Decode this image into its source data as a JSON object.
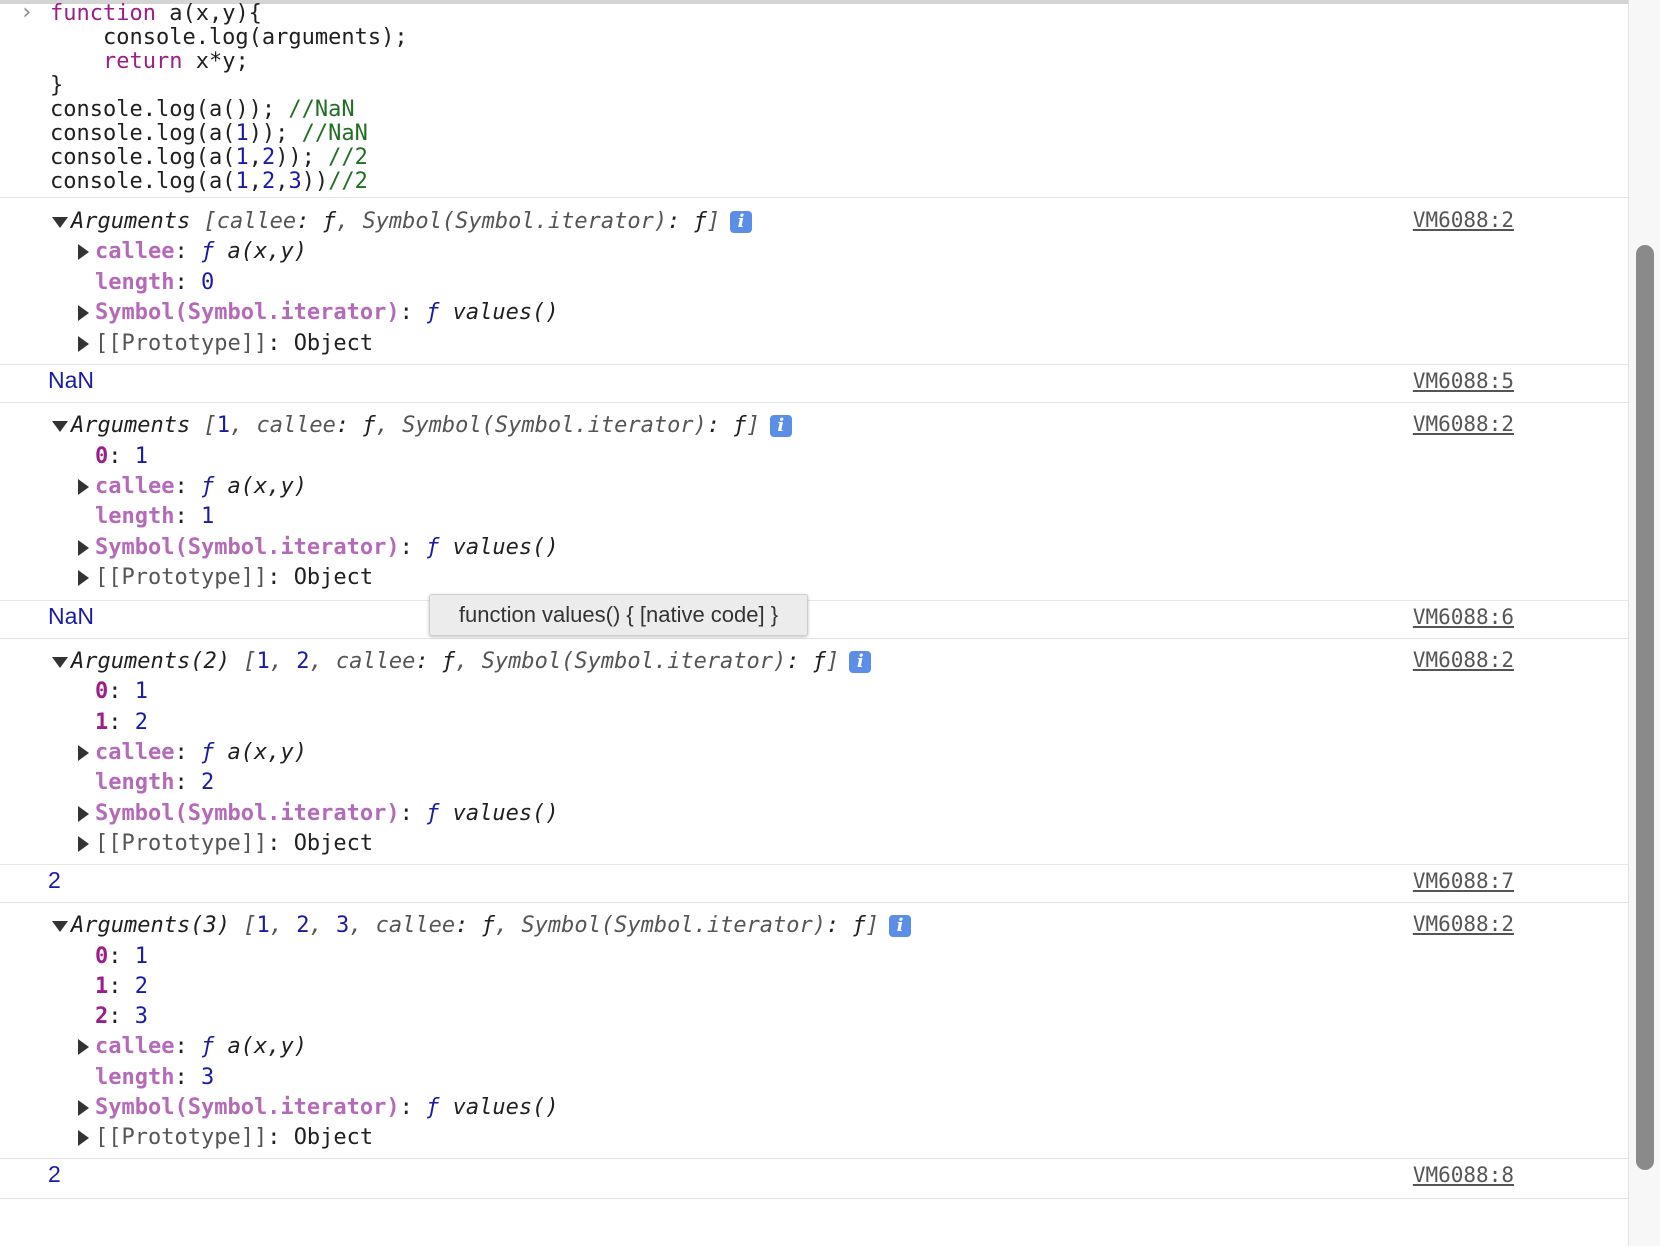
{
  "input": {
    "prompt_symbol": "›",
    "code": [
      {
        "parts": [
          {
            "c": "kw",
            "t": "function"
          },
          {
            "c": "",
            "t": " a(x,y){"
          }
        ]
      },
      {
        "parts": [
          {
            "c": "",
            "t": "    console.log(arguments);"
          }
        ]
      },
      {
        "parts": [
          {
            "c": "",
            "t": "    "
          },
          {
            "c": "kw",
            "t": "return"
          },
          {
            "c": "",
            "t": " x*y;"
          }
        ]
      },
      {
        "parts": [
          {
            "c": "",
            "t": "}"
          }
        ]
      },
      {
        "parts": [
          {
            "c": "",
            "t": "console.log(a()); "
          },
          {
            "c": "cm",
            "t": "//NaN"
          }
        ]
      },
      {
        "parts": [
          {
            "c": "",
            "t": "console.log(a("
          },
          {
            "c": "num",
            "t": "1"
          },
          {
            "c": "",
            "t": ")); "
          },
          {
            "c": "cm",
            "t": "//NaN"
          }
        ]
      },
      {
        "parts": [
          {
            "c": "",
            "t": "console.log(a("
          },
          {
            "c": "num",
            "t": "1"
          },
          {
            "c": "",
            "t": ","
          },
          {
            "c": "num",
            "t": "2"
          },
          {
            "c": "",
            "t": ")); "
          },
          {
            "c": "cm",
            "t": "//2"
          }
        ]
      },
      {
        "parts": [
          {
            "c": "",
            "t": "console.log(a("
          },
          {
            "c": "num",
            "t": "1"
          },
          {
            "c": "",
            "t": ","
          },
          {
            "c": "num",
            "t": "2"
          },
          {
            "c": "",
            "t": ","
          },
          {
            "c": "num",
            "t": "3"
          },
          {
            "c": "",
            "t": "))"
          },
          {
            "c": "cm",
            "t": "//2"
          }
        ]
      }
    ]
  },
  "groups": [
    {
      "source": "VM6088:2",
      "summary": [
        {
          "c": "it",
          "t": "Arguments "
        },
        {
          "c": "it gy",
          "t": "["
        },
        {
          "c": "it gy",
          "t": "callee"
        },
        {
          "c": "it",
          "t": ": "
        },
        {
          "c": "it",
          "t": "ƒ"
        },
        {
          "c": "it gy",
          "t": ", "
        },
        {
          "c": "it gy",
          "t": "Symbol(Symbol.iterator)"
        },
        {
          "c": "it",
          "t": ": ƒ"
        },
        {
          "c": "it gy",
          "t": "]"
        }
      ],
      "props": [
        {
          "kind": "obj",
          "key": "callee",
          "keyc": "pf",
          "val": [
            {
              "c": "fn",
              "t": "ƒ"
            },
            {
              "c": "it",
              "t": " a(x,y)"
            }
          ]
        },
        {
          "kind": "leaf",
          "key": "length",
          "keyc": "pf",
          "val": [
            {
              "c": "num",
              "t": "0"
            }
          ]
        },
        {
          "kind": "obj",
          "key": "Symbol(Symbol.iterator)",
          "keyc": "pf",
          "val": [
            {
              "c": "fn",
              "t": "ƒ"
            },
            {
              "c": "it",
              "t": " values()"
            }
          ]
        },
        {
          "kind": "obj",
          "key": "[[Prototype]]",
          "keyc": "gy",
          "val": [
            {
              "c": "",
              "t": "Object"
            }
          ]
        }
      ],
      "result": {
        "value": "NaN",
        "source": "VM6088:5"
      }
    },
    {
      "source": "VM6088:2",
      "summary": [
        {
          "c": "it",
          "t": "Arguments "
        },
        {
          "c": "it gy",
          "t": "["
        },
        {
          "c": "num",
          "t": "1"
        },
        {
          "c": "it gy",
          "t": ", callee"
        },
        {
          "c": "it",
          "t": ": ƒ"
        },
        {
          "c": "it gy",
          "t": ", Symbol(Symbol.iterator)"
        },
        {
          "c": "it",
          "t": ": ƒ"
        },
        {
          "c": "it gy",
          "t": "]"
        }
      ],
      "props": [
        {
          "kind": "leaf",
          "key": "0",
          "keyc": "pk",
          "val": [
            {
              "c": "num",
              "t": "1"
            }
          ]
        },
        {
          "kind": "obj",
          "key": "callee",
          "keyc": "pf",
          "val": [
            {
              "c": "fn",
              "t": "ƒ"
            },
            {
              "c": "it",
              "t": " a(x,y)"
            }
          ]
        },
        {
          "kind": "leaf",
          "key": "length",
          "keyc": "pf",
          "val": [
            {
              "c": "num",
              "t": "1"
            }
          ]
        },
        {
          "kind": "obj",
          "key": "Symbol(Symbol.iterator)",
          "keyc": "pf",
          "val": [
            {
              "c": "fn",
              "t": "ƒ"
            },
            {
              "c": "it",
              "t": " values()"
            }
          ]
        },
        {
          "kind": "obj",
          "key": "[[Prototype]]",
          "keyc": "gy",
          "val": [
            {
              "c": "",
              "t": "Object"
            }
          ]
        }
      ],
      "result": {
        "value": "NaN",
        "source": "VM6088:6"
      }
    },
    {
      "source": "VM6088:2",
      "summary": [
        {
          "c": "it",
          "t": "Arguments(2) "
        },
        {
          "c": "it gy",
          "t": "["
        },
        {
          "c": "num",
          "t": "1"
        },
        {
          "c": "it gy",
          "t": ", "
        },
        {
          "c": "num",
          "t": "2"
        },
        {
          "c": "it gy",
          "t": ", callee"
        },
        {
          "c": "it",
          "t": ": ƒ"
        },
        {
          "c": "it gy",
          "t": ", Symbol(Symbol.iterator)"
        },
        {
          "c": "it",
          "t": ": ƒ"
        },
        {
          "c": "it gy",
          "t": "]"
        }
      ],
      "props": [
        {
          "kind": "leaf",
          "key": "0",
          "keyc": "pk",
          "val": [
            {
              "c": "num",
              "t": "1"
            }
          ]
        },
        {
          "kind": "leaf",
          "key": "1",
          "keyc": "pk",
          "val": [
            {
              "c": "num",
              "t": "2"
            }
          ]
        },
        {
          "kind": "obj",
          "key": "callee",
          "keyc": "pf",
          "val": [
            {
              "c": "fn",
              "t": "ƒ"
            },
            {
              "c": "it",
              "t": " a(x,y)"
            }
          ]
        },
        {
          "kind": "leaf",
          "key": "length",
          "keyc": "pf",
          "val": [
            {
              "c": "num",
              "t": "2"
            }
          ]
        },
        {
          "kind": "obj",
          "key": "Symbol(Symbol.iterator)",
          "keyc": "pf",
          "val": [
            {
              "c": "fn",
              "t": "ƒ"
            },
            {
              "c": "it",
              "t": " values()"
            }
          ]
        },
        {
          "kind": "obj",
          "key": "[[Prototype]]",
          "keyc": "gy",
          "val": [
            {
              "c": "",
              "t": "Object"
            }
          ]
        }
      ],
      "result": {
        "value": "2",
        "source": "VM6088:7"
      }
    },
    {
      "source": "VM6088:2",
      "summary": [
        {
          "c": "it",
          "t": "Arguments(3) "
        },
        {
          "c": "it gy",
          "t": "["
        },
        {
          "c": "num",
          "t": "1"
        },
        {
          "c": "it gy",
          "t": ", "
        },
        {
          "c": "num",
          "t": "2"
        },
        {
          "c": "it gy",
          "t": ", "
        },
        {
          "c": "num",
          "t": "3"
        },
        {
          "c": "it gy",
          "t": ", callee"
        },
        {
          "c": "it",
          "t": ": ƒ"
        },
        {
          "c": "it gy",
          "t": ", Symbol(Symbol.iterator)"
        },
        {
          "c": "it",
          "t": ": ƒ"
        },
        {
          "c": "it gy",
          "t": "]"
        }
      ],
      "props": [
        {
          "kind": "leaf",
          "key": "0",
          "keyc": "pk",
          "val": [
            {
              "c": "num",
              "t": "1"
            }
          ]
        },
        {
          "kind": "leaf",
          "key": "1",
          "keyc": "pk",
          "val": [
            {
              "c": "num",
              "t": "2"
            }
          ]
        },
        {
          "kind": "leaf",
          "key": "2",
          "keyc": "pk",
          "val": [
            {
              "c": "num",
              "t": "3"
            }
          ]
        },
        {
          "kind": "obj",
          "key": "callee",
          "keyc": "pf",
          "val": [
            {
              "c": "fn",
              "t": "ƒ"
            },
            {
              "c": "it",
              "t": " a(x,y)"
            }
          ]
        },
        {
          "kind": "leaf",
          "key": "length",
          "keyc": "pf",
          "val": [
            {
              "c": "num",
              "t": "3"
            }
          ]
        },
        {
          "kind": "obj",
          "key": "Symbol(Symbol.iterator)",
          "keyc": "pf",
          "val": [
            {
              "c": "fn",
              "t": "ƒ"
            },
            {
              "c": "it",
              "t": " values()"
            }
          ]
        },
        {
          "kind": "obj",
          "key": "[[Prototype]]",
          "keyc": "gy",
          "val": [
            {
              "c": "",
              "t": "Object"
            }
          ]
        }
      ],
      "result": {
        "value": "2",
        "source": "VM6088:8"
      }
    }
  ],
  "tooltip": {
    "text": "function values() { [native code] }"
  },
  "icons": {
    "info": "info-icon",
    "expand": "triangle-right-icon",
    "collapse": "triangle-down-icon"
  }
}
